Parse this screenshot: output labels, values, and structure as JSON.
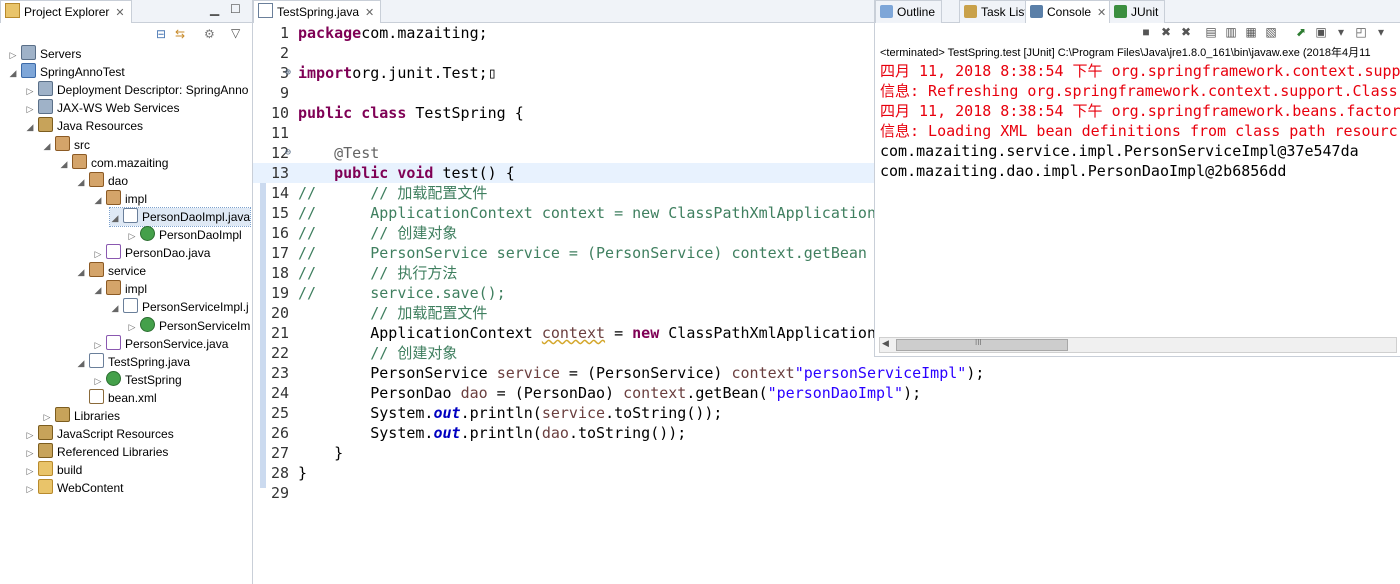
{
  "project_explorer": {
    "tab_label": "Project Explorer",
    "tree": [
      {
        "label": "Servers",
        "depth": 0,
        "twisty": "▷",
        "icon": "server"
      },
      {
        "label": "SpringAnnoTest",
        "depth": 0,
        "twisty": "◢",
        "icon": "proj"
      },
      {
        "label": "Deployment Descriptor: SpringAnno",
        "depth": 1,
        "twisty": "▷",
        "icon": "server"
      },
      {
        "label": "JAX-WS Web Services",
        "depth": 1,
        "twisty": "▷",
        "icon": "server"
      },
      {
        "label": "Java Resources",
        "depth": 1,
        "twisty": "◢",
        "icon": "lib"
      },
      {
        "label": "src",
        "depth": 2,
        "twisty": "◢",
        "icon": "pkg"
      },
      {
        "label": "com.mazaiting",
        "depth": 3,
        "twisty": "◢",
        "icon": "pkg"
      },
      {
        "label": "dao",
        "depth": 4,
        "twisty": "◢",
        "icon": "pkg"
      },
      {
        "label": "impl",
        "depth": 5,
        "twisty": "◢",
        "icon": "pkg"
      },
      {
        "label": "PersonDaoImpl.java",
        "depth": 6,
        "twisty": "◢",
        "icon": "java",
        "selected": true
      },
      {
        "label": "PersonDaoImpl",
        "depth": 7,
        "twisty": "▷",
        "icon": "class"
      },
      {
        "label": "PersonDao.java",
        "depth": 5,
        "twisty": "▷",
        "icon": "iface"
      },
      {
        "label": "service",
        "depth": 4,
        "twisty": "◢",
        "icon": "pkg"
      },
      {
        "label": "impl",
        "depth": 5,
        "twisty": "◢",
        "icon": "pkg"
      },
      {
        "label": "PersonServiceImpl.j",
        "depth": 6,
        "twisty": "◢",
        "icon": "java"
      },
      {
        "label": "PersonServiceIm",
        "depth": 7,
        "twisty": "▷",
        "icon": "class"
      },
      {
        "label": "PersonService.java",
        "depth": 5,
        "twisty": "▷",
        "icon": "iface"
      },
      {
        "label": "TestSpring.java",
        "depth": 4,
        "twisty": "◢",
        "icon": "java"
      },
      {
        "label": "TestSpring",
        "depth": 5,
        "twisty": "▷",
        "icon": "class"
      },
      {
        "label": "bean.xml",
        "depth": 4,
        "twisty": "",
        "icon": "xml"
      },
      {
        "label": "Libraries",
        "depth": 2,
        "twisty": "▷",
        "icon": "lib"
      },
      {
        "label": "JavaScript Resources",
        "depth": 1,
        "twisty": "▷",
        "icon": "lib"
      },
      {
        "label": "Referenced Libraries",
        "depth": 1,
        "twisty": "▷",
        "icon": "lib"
      },
      {
        "label": "build",
        "depth": 1,
        "twisty": "▷",
        "icon": "folder"
      },
      {
        "label": "WebContent",
        "depth": 1,
        "twisty": "▷",
        "icon": "folder"
      }
    ]
  },
  "editor": {
    "tab_label": "TestSpring.java",
    "current_line": 13,
    "lines": [
      {
        "n": "1",
        "m": "",
        "tokens": [
          [
            "kw",
            "package"
          ],
          [
            "",
            "com.mazaiting;"
          ]
        ]
      },
      {
        "n": "2",
        "m": "",
        "tokens": []
      },
      {
        "n": "3",
        "m": "⊕",
        "tokens": [
          [
            "kw",
            "import"
          ],
          [
            "",
            "org.junit.Test;▯"
          ]
        ]
      },
      {
        "n": "9",
        "m": "",
        "tokens": []
      },
      {
        "n": "10",
        "m": "",
        "tokens": [
          [
            "kw",
            "public class"
          ],
          [
            "",
            " TestSpring {"
          ]
        ]
      },
      {
        "n": "11",
        "m": "",
        "tokens": []
      },
      {
        "n": "12",
        "m": "⊖",
        "tokens": [
          [
            "",
            "    "
          ],
          [
            "an",
            "@Test"
          ]
        ]
      },
      {
        "n": "13",
        "m": "",
        "tokens": [
          [
            "",
            "    "
          ],
          [
            "kw",
            "public void"
          ],
          [
            "",
            " test() {"
          ]
        ]
      },
      {
        "n": "14",
        "m": "",
        "tokens": [
          [
            "cm",
            "//      // 加载配置文件"
          ]
        ]
      },
      {
        "n": "15",
        "m": "",
        "tokens": [
          [
            "cm",
            "//      ApplicationContext context = new ClassPathXmlApplication"
          ]
        ]
      },
      {
        "n": "16",
        "m": "",
        "tokens": [
          [
            "cm",
            "//      // 创建对象"
          ]
        ]
      },
      {
        "n": "17",
        "m": "",
        "tokens": [
          [
            "cm",
            "//      PersonService service = (PersonService) context.getBean"
          ]
        ]
      },
      {
        "n": "18",
        "m": "",
        "tokens": [
          [
            "cm",
            "//      // 执行方法"
          ]
        ]
      },
      {
        "n": "19",
        "m": "",
        "tokens": [
          [
            "cm",
            "//      service.save();"
          ]
        ]
      },
      {
        "n": "20",
        "m": "",
        "tokens": [
          [
            "",
            "        "
          ],
          [
            "cm",
            "// 加载配置文件"
          ]
        ]
      },
      {
        "n": "21",
        "m": "",
        "tokens": [
          [
            "",
            "        ApplicationContext "
          ],
          [
            "ul vv",
            "context"
          ],
          [
            "",
            " = "
          ],
          [
            "kw",
            "new"
          ],
          [
            "",
            " ClassPathXmlApplication"
          ]
        ]
      },
      {
        "n": "22",
        "m": "",
        "tokens": [
          [
            "",
            "        "
          ],
          [
            "cm",
            "// 创建对象"
          ]
        ]
      },
      {
        "n": "23",
        "m": "",
        "tokens": [
          [
            "",
            "        PersonService "
          ],
          [
            "vv",
            "service"
          ],
          [
            "",
            " = (PersonService) "
          ],
          [
            "vv",
            "context"
          ],
          [
            ".getBean("
          ],
          [
            "st",
            "\"personServiceImpl\""
          ],
          [
            "",
            ");"
          ]
        ]
      },
      {
        "n": "24",
        "m": "",
        "tokens": [
          [
            "",
            "        PersonDao "
          ],
          [
            "vv",
            "dao"
          ],
          [
            "",
            " = (PersonDao) "
          ],
          [
            "vv",
            "context"
          ],
          [
            "",
            ".getBean("
          ],
          [
            "st",
            "\"personDaoImpl\""
          ],
          [
            "",
            ");"
          ]
        ]
      },
      {
        "n": "25",
        "m": "",
        "tokens": [
          [
            "",
            "        System."
          ],
          [
            "fi",
            "out"
          ],
          [
            "",
            ".println("
          ],
          [
            "vv",
            "service"
          ],
          [
            "",
            ".toString());"
          ]
        ]
      },
      {
        "n": "26",
        "m": "",
        "tokens": [
          [
            "",
            "        System."
          ],
          [
            "fi",
            "out"
          ],
          [
            "",
            ".println("
          ],
          [
            "vv",
            "dao"
          ],
          [
            "",
            ".toString());"
          ]
        ]
      },
      {
        "n": "27",
        "m": "",
        "tokens": [
          [
            "",
            "    }"
          ]
        ]
      },
      {
        "n": "28",
        "m": "",
        "tokens": [
          [
            "",
            "}"
          ]
        ]
      },
      {
        "n": "29",
        "m": "",
        "tokens": []
      }
    ]
  },
  "console_panel": {
    "tabs": [
      {
        "label": "Outline",
        "icon": "outline-icon"
      },
      {
        "label": "Task List",
        "icon": "task-list-icon"
      },
      {
        "label": "Console",
        "icon": "console-icon",
        "active": true
      },
      {
        "label": "JUnit",
        "icon": "junit-icon"
      }
    ],
    "status": "<terminated> TestSpring.test [JUnit] C:\\Program Files\\Java\\jre1.8.0_161\\bin\\javaw.exe (2018年4月11",
    "output": [
      {
        "text": "四月 11, 2018 8:38:54 下午 org.springframework.context.suppo",
        "error": true
      },
      {
        "text": "信息: Refreshing org.springframework.context.support.Class",
        "error": true
      },
      {
        "text": "四月 11, 2018 8:38:54 下午 org.springframework.beans.factory",
        "error": true
      },
      {
        "text": "信息: Loading XML bean definitions from class path resourc",
        "error": true
      },
      {
        "text": "com.mazaiting.service.impl.PersonServiceImpl@37e547da",
        "error": false
      },
      {
        "text": "com.mazaiting.dao.impl.PersonDaoImpl@2b6856dd",
        "error": false
      }
    ],
    "scroll_grip": "III"
  }
}
